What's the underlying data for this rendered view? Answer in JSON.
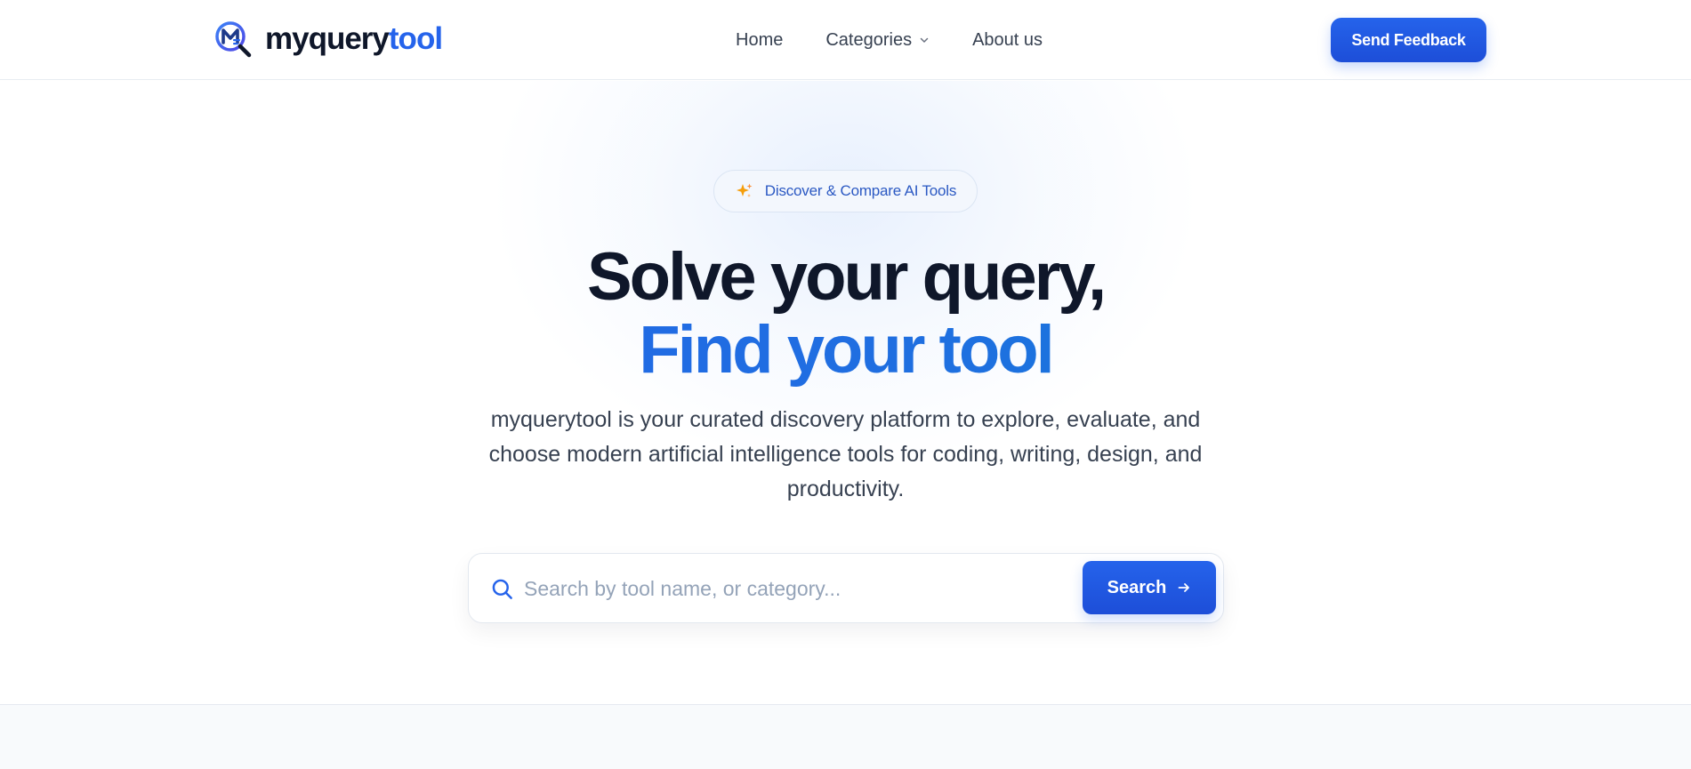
{
  "header": {
    "logo": {
      "text_part1": "myquery",
      "text_part2": "tool",
      "icon": "magnifier-m-logo-icon"
    },
    "nav": [
      {
        "label": "Home"
      },
      {
        "label": "Categories",
        "icon": "chevron-down-icon"
      },
      {
        "label": "About us"
      }
    ],
    "feedback_button": "Send Feedback"
  },
  "hero": {
    "badge": {
      "icon": "sparkle-icon",
      "text": "Discover & Compare AI Tools"
    },
    "title_line1": "Solve your query,",
    "title_line2": "Find your tool",
    "description": "myquerytool is your curated discovery platform to explore, evaluate, and choose modern artificial intelligence tools for coding, writing, design, and productivity.",
    "search": {
      "placeholder": "Search by tool name, or category...",
      "value": "",
      "button_label": "Search",
      "icon": "search-icon",
      "button_icon": "arrow-right-icon"
    }
  },
  "colors": {
    "brand": "#2563eb",
    "text_dark": "#0f172a",
    "text_body": "#374151",
    "badge_text": "#2b59c3",
    "placeholder": "#94a3b8"
  }
}
